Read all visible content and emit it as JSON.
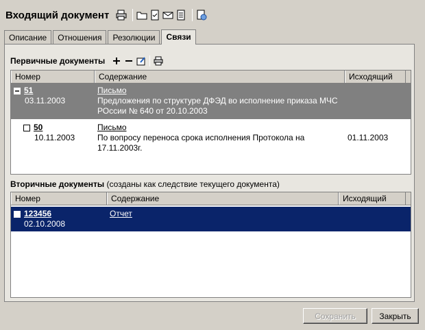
{
  "header": {
    "title": "Входящий документ"
  },
  "tabs": [
    {
      "label": "Описание"
    },
    {
      "label": "Отношения"
    },
    {
      "label": "Резолюции"
    },
    {
      "label": "Связи"
    }
  ],
  "primary": {
    "title": "Первичные документы",
    "columns": [
      "Номер",
      "Содержание",
      "Исходящий"
    ],
    "rows": [
      {
        "number": "51",
        "date": "03.11.2003",
        "type": "Письмо",
        "content": "Предложения по структуре ДФЭД во исполнение приказа МЧС РОссии № 640 от 20.10.2003",
        "outgoing": ""
      },
      {
        "number": "50",
        "date": "10.11.2003",
        "type": "Письмо",
        "content": "По вопросу переноса срока исполнения Протокола на 17.11.2003г.",
        "outgoing": "01.11.2003"
      }
    ]
  },
  "secondary": {
    "title": "Вторичные документы",
    "subtitle": "(созданы как следствие текущего документа)",
    "columns": [
      "Номер",
      "Содержание",
      "Исходящий"
    ],
    "rows": [
      {
        "number": "123456",
        "date": "02.10.2008",
        "type": "Отчет"
      }
    ]
  },
  "buttons": {
    "save": "Сохранить",
    "close": "Закрыть"
  },
  "colors": {
    "selected_row": "#0a246a",
    "parent_row": "#808080",
    "panel": "#e8e6e0"
  }
}
